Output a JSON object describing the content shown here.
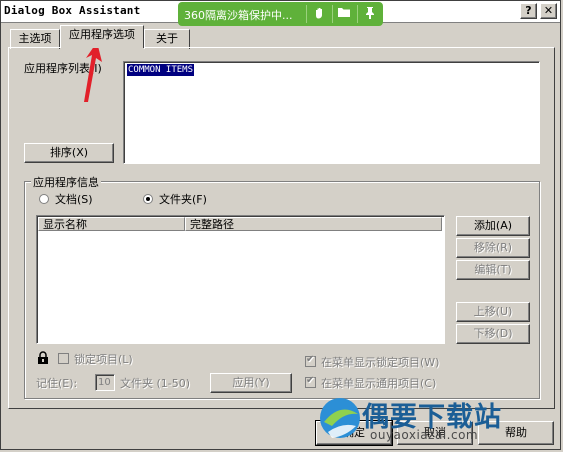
{
  "window": {
    "title": "Dialog Box Assistant",
    "help_btn": "?",
    "close_btn": "✕"
  },
  "sandbox": {
    "text": "360隔离沙箱保护中..."
  },
  "tabs": [
    {
      "label": "主选项"
    },
    {
      "label": "应用程序选项"
    },
    {
      "label": "关于"
    }
  ],
  "app_list": {
    "label": "应用程序列表(I)",
    "items": [
      "COMMON ITEMS"
    ]
  },
  "sort_button": "排序(X)",
  "app_info": {
    "label": "应用程序信息",
    "radio_documents": "文档(S)",
    "radio_folders": "文件夹(F)",
    "selected": "文件夹(F)",
    "columns": [
      "显示名称",
      "完整路径"
    ]
  },
  "side_buttons": {
    "add": "添加(A)",
    "remove": "移除(R)",
    "edit": "编辑(T)",
    "up": "上移(U)",
    "down": "下移(D)"
  },
  "bottom": {
    "lock_items": "锁定项目(L)",
    "remember": "记住(E):",
    "remember_value": "10",
    "folder_range": "文件夹 (1-50)",
    "apply": "应用(Y)",
    "show_locked": "在菜单显示锁定项目(W)",
    "show_common": "在菜单显示通用项目(C)"
  },
  "dialog_buttons": {
    "ok": "确定",
    "cancel": "取消",
    "help": "帮助"
  },
  "watermark": {
    "text": "偶要下载站",
    "url": "ouyaoxiazai.com"
  },
  "colors": {
    "face": "#d4d0c8",
    "sandbox_green": "#5fb13a",
    "highlight": "#000080",
    "arrow": "#e2202a"
  }
}
